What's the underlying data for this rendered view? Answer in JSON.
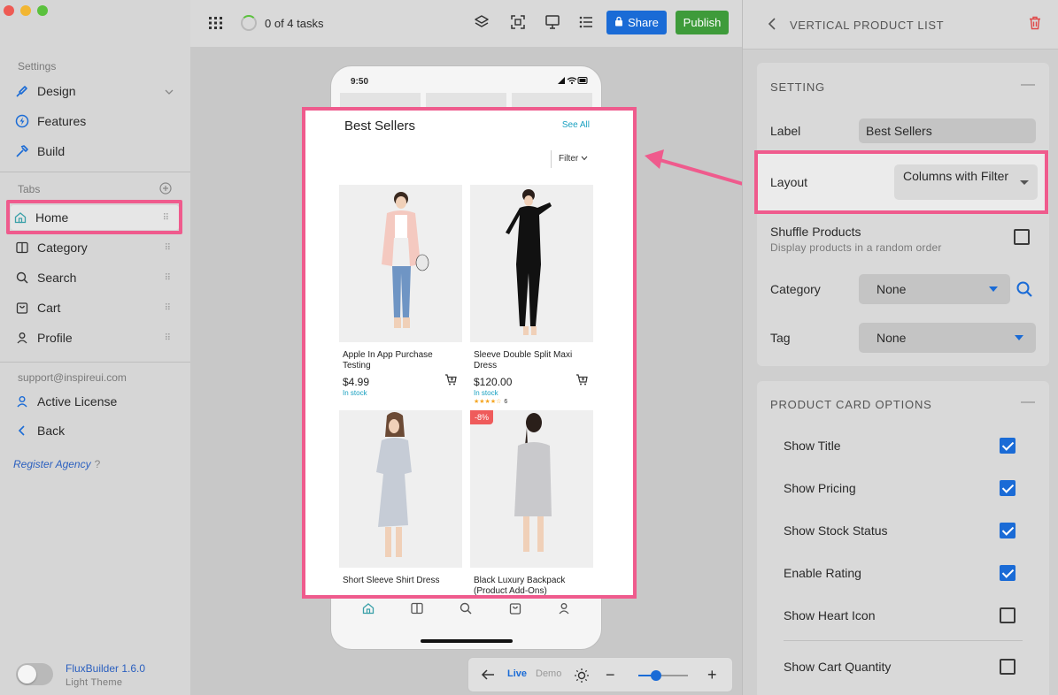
{
  "sidebar": {
    "settings_header": "Settings",
    "settings_items": [
      {
        "label": "Design",
        "icon": "brush-icon"
      },
      {
        "label": "Features",
        "icon": "bolt-icon"
      },
      {
        "label": "Build",
        "icon": "hammer-icon"
      }
    ],
    "tabs_header": "Tabs",
    "tabs": [
      {
        "label": "Home",
        "icon": "home-icon"
      },
      {
        "label": "Category",
        "icon": "columns-icon"
      },
      {
        "label": "Search",
        "icon": "search-icon"
      },
      {
        "label": "Cart",
        "icon": "bag-icon"
      },
      {
        "label": "Profile",
        "icon": "person-icon"
      }
    ],
    "support_email": "support@inspireui.com",
    "account_items": [
      {
        "label": "Active License",
        "icon": "person-icon"
      },
      {
        "label": "Back",
        "icon": "chevron-left-icon"
      }
    ],
    "register_agency": "Register Agency",
    "register_help": "?",
    "app_version": "FluxBuilder 1.6.0",
    "theme_label": "Light Theme"
  },
  "topbar": {
    "tasks": "0 of 4 tasks",
    "share_label": "Share",
    "publish_label": "Publish"
  },
  "phone": {
    "time": "9:50",
    "section_title": "Best Sellers",
    "see_all": "See All",
    "filter_label": "Filter",
    "products": [
      {
        "name": "Apple In App Purchase Testing",
        "price": "$4.99",
        "stock": "In stock",
        "rating": "",
        "rating_count": "",
        "badge": ""
      },
      {
        "name": "Sleeve Double Split Maxi Dress",
        "price": "$120.00",
        "stock": "In stock",
        "rating": "★★★★☆",
        "rating_count": "6",
        "badge": ""
      },
      {
        "name": "Short Sleeve Shirt Dress",
        "price": "",
        "stock": "",
        "rating": "",
        "rating_count": "",
        "badge": ""
      },
      {
        "name": "Black Luxury Backpack (Product Add-Ons)",
        "price": "",
        "stock": "",
        "rating": "",
        "rating_count": "",
        "badge": "-8%"
      }
    ]
  },
  "preview_bar": {
    "live": "Live",
    "demo": "Demo",
    "zoom_level": 0.35
  },
  "panel": {
    "title": "VERTICAL PRODUCT LIST",
    "setting_header": "SETTING",
    "label_label": "Label",
    "label_value": "Best Sellers",
    "layout_label": "Layout",
    "layout_value": "Columns with Filter",
    "shuffle_label": "Shuffle Products",
    "shuffle_desc": "Display products in a random order",
    "category_label": "Category",
    "category_value": "None",
    "tag_label": "Tag",
    "tag_value": "None",
    "card_options_header": "PRODUCT CARD OPTIONS",
    "options": [
      {
        "label": "Show Title",
        "checked": true
      },
      {
        "label": "Show Pricing",
        "checked": true
      },
      {
        "label": "Show Stock Status",
        "checked": true
      },
      {
        "label": "Enable Rating",
        "checked": true
      },
      {
        "label": "Show Heart Icon",
        "checked": false
      },
      {
        "label": "Show Cart Quantity",
        "checked": false
      }
    ]
  },
  "colors": {
    "accent": "#1a6bd6",
    "publish": "#3e9b3a",
    "highlight": "#ef5b8d",
    "stock": "#18a0c0"
  }
}
